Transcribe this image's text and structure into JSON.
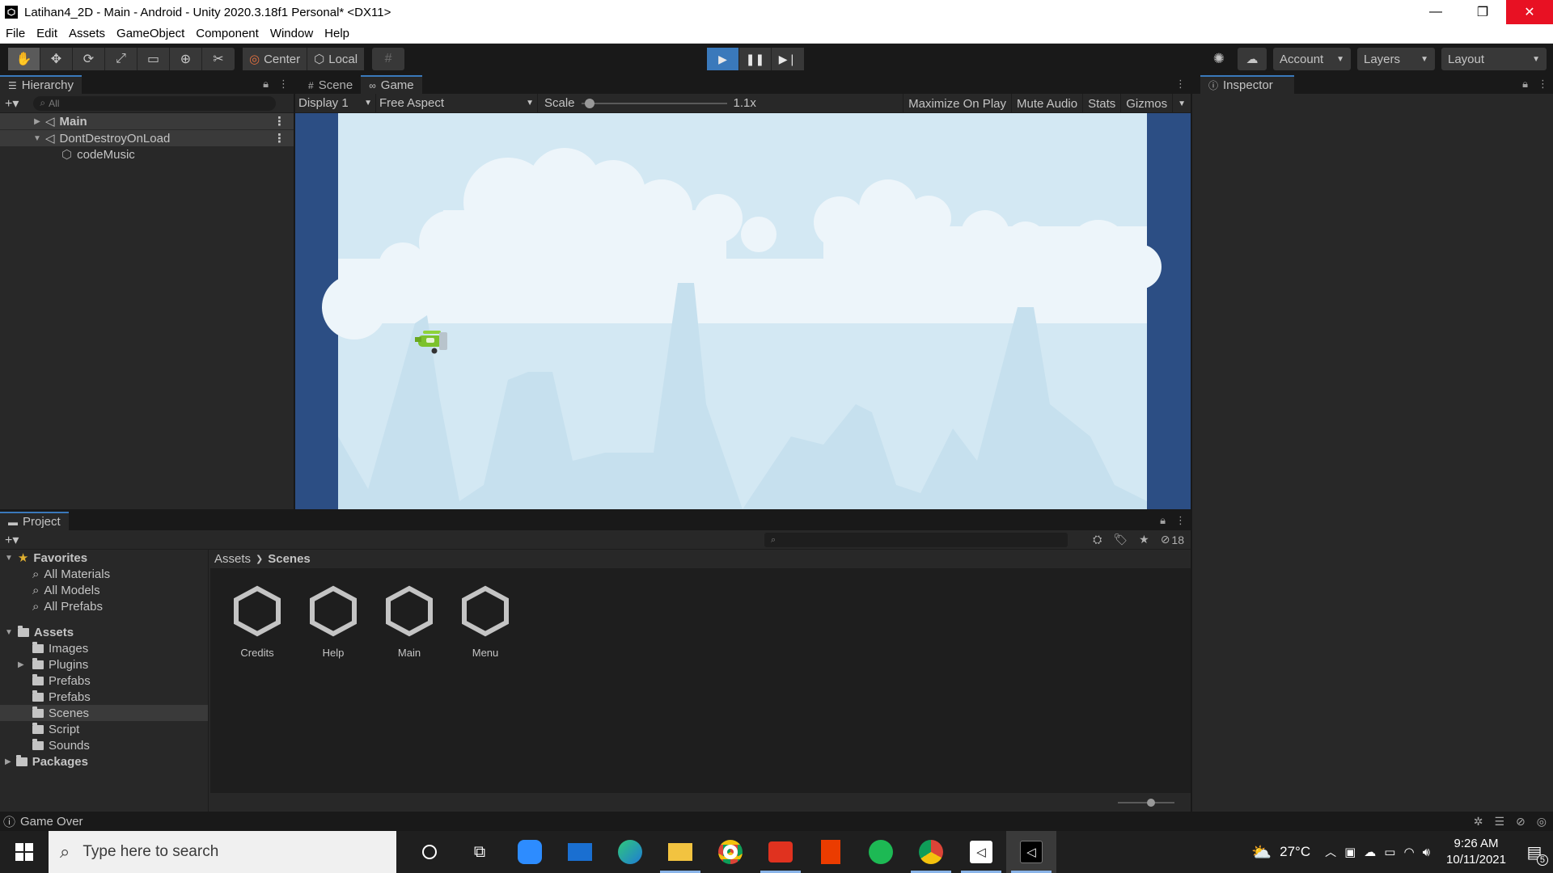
{
  "window": {
    "title": "Latihan4_2D - Main - Android - Unity 2020.3.18f1 Personal* <DX11>",
    "min": "—",
    "max": "❐",
    "close": "✕"
  },
  "menu": [
    "File",
    "Edit",
    "Assets",
    "GameObject",
    "Component",
    "Window",
    "Help"
  ],
  "toolbar": {
    "pivot": "Center",
    "space": "Local",
    "account": "Account",
    "layers": "Layers",
    "layout": "Layout"
  },
  "hierarchy": {
    "tab": "Hierarchy",
    "search_placeholder": "All",
    "rows": [
      {
        "label": "Main"
      },
      {
        "label": "DontDestroyOnLoad"
      },
      {
        "label": "codeMusic"
      }
    ]
  },
  "views": {
    "scene_tab": "Scene",
    "game_tab": "Game",
    "display": "Display 1",
    "aspect": "Free Aspect",
    "scale_label": "Scale",
    "scale_value": "1.1x",
    "scale_fraction": 0.06,
    "maximize": "Maximize On Play",
    "mute": "Mute Audio",
    "stats": "Stats",
    "gizmos": "Gizmos"
  },
  "inspector": {
    "tab": "Inspector"
  },
  "project": {
    "tab": "Project",
    "hidden_count": "18",
    "favorites": {
      "label": "Favorites",
      "items": [
        "All Materials",
        "All Models",
        "All Prefabs"
      ]
    },
    "assets": {
      "label": "Assets",
      "items": [
        "Images",
        "Plugins",
        "Prefabs",
        "Prefabs",
        "Scenes",
        "Script",
        "Sounds"
      ]
    },
    "packages": "Packages",
    "breadcrumb": [
      "Assets",
      "Scenes"
    ],
    "files": [
      "Credits",
      "Help",
      "Main",
      "Menu"
    ]
  },
  "status": {
    "message": "Game Over"
  },
  "taskbar": {
    "search_placeholder": "Type here to search",
    "temperature": "27°C",
    "time": "9:26 AM",
    "date": "10/11/2021",
    "notifications": "5"
  },
  "colors": {
    "accent": "#3a79bb",
    "sky": "#d3e8f3",
    "cloud": "#edf5fa",
    "mountain": "#c6e0ee",
    "letterbox": "#2c4e84"
  }
}
